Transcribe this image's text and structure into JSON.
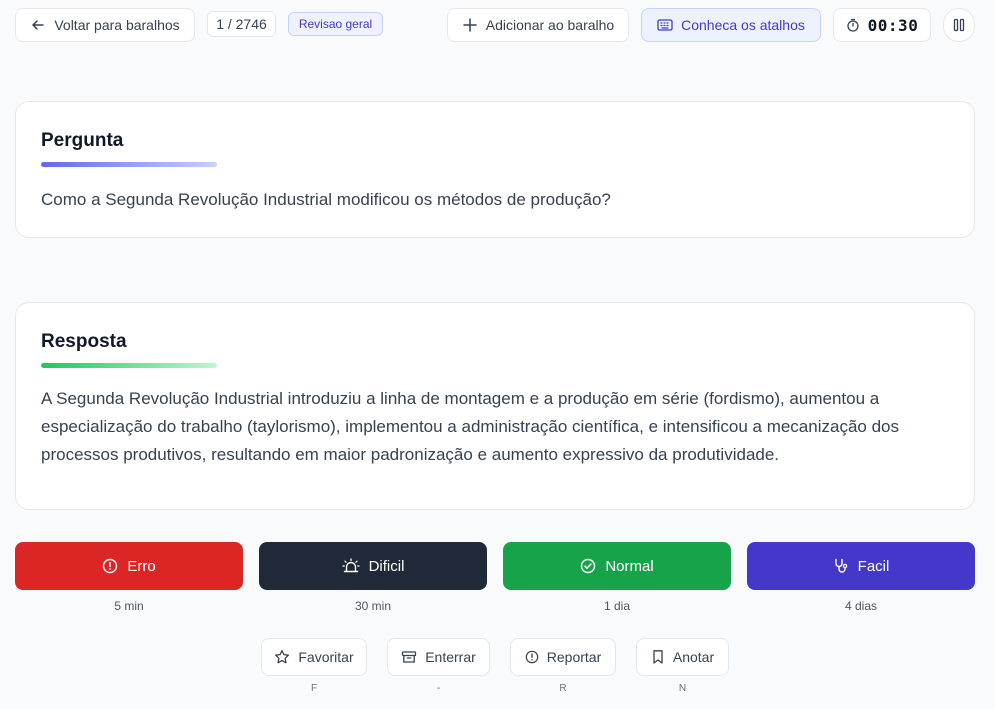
{
  "topbar": {
    "back_label": "Voltar para baralhos",
    "counter": "1 / 2746",
    "badge": "Revisao geral",
    "add_label": "Adicionar ao baralho",
    "shortcuts_label": "Conheca os atalhos",
    "timer": "00:30"
  },
  "question": {
    "title": "Pergunta",
    "text": "Como a Segunda Revolução Industrial modificou os métodos de produção?"
  },
  "answer": {
    "title": "Resposta",
    "text": "A Segunda Revolução Industrial introduziu a linha de montagem e a produção em série (fordismo), aumentou a especialização do trabalho (taylorismo), implementou a administração científica, e intensificou a mecanização dos processos produtivos, resultando em maior padronização e aumento expressivo da produtividade."
  },
  "ratings": [
    {
      "label": "Erro",
      "interval": "5 min",
      "color": "#dc2626"
    },
    {
      "label": "Dificil",
      "interval": "30 min",
      "color": "#1f2937"
    },
    {
      "label": "Normal",
      "interval": "1 dia",
      "color": "#16a34a"
    },
    {
      "label": "Facil",
      "interval": "4 dias",
      "color": "#4338ca"
    }
  ],
  "actions": [
    {
      "label": "Favoritar",
      "key": "F",
      "icon": "star-icon"
    },
    {
      "label": "Enterrar",
      "key": "-",
      "icon": "archive-icon"
    },
    {
      "label": "Reportar",
      "key": "R",
      "icon": "alert-circle-icon"
    },
    {
      "label": "Anotar",
      "key": "N",
      "icon": "bookmark-icon"
    }
  ]
}
